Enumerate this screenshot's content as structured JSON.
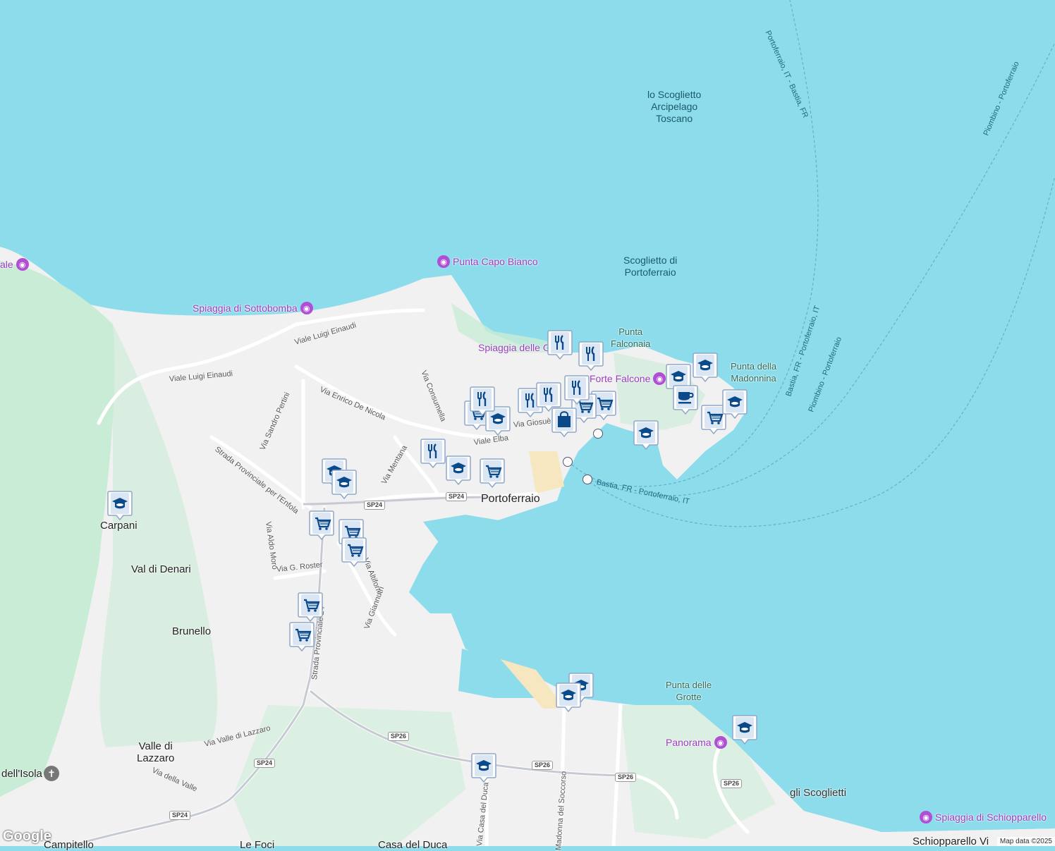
{
  "map": {
    "colors": {
      "water": "#8ddcec",
      "land": "#f2f2f2",
      "park": "#c8ecd4",
      "road": "#ffffff",
      "marker_blue": "#0b4a8a"
    },
    "water_labels": {
      "scoglietto_arcipelago": "lo Scoglietto\nArcipelago\nToscano",
      "scoglietto_portoferraio": "Scoglietto di\nPortoferraio",
      "punta_falconaia": "Punta\nFalconaia",
      "punta_madonnina": "Punta della\nMadonnina",
      "punta_grotte": "Punta delle\nGrotte",
      "gli_scoglietti": "gli Scoglietti"
    },
    "places": {
      "portoferraio": "Portoferraio",
      "carpani": "Carpani",
      "val_di_denari": "Val di Denari",
      "brunello": "Brunello",
      "valle_di_lazzaro": "Valle di\nLazzaro",
      "dell_isola": "dell'Isola",
      "campitello": "Campitello",
      "le_foci": "Le Foci",
      "casa_del_duca": "Casa del Duca",
      "schiopparello": "Schiopparello Vi"
    },
    "pois": {
      "punta_capo_bianco": "Punta Capo Bianco",
      "spiaggia_sottobomba": "Spiaggia di Sottobomba",
      "spiaggia_ghiaie": "Spiaggia delle G",
      "forte_falcone": "Forte Falcone",
      "panorama": "Panorama",
      "spiaggia_schiopparello": "Spiaggia di Schiopparello",
      "left_edge": "ale"
    },
    "roads": {
      "viale_luigi_einaudi_1": "Viale Luigi Einaudi",
      "viale_luigi_einaudi_2": "Viale Luigi Einaudi",
      "via_enrico_de_nicola": "Via Enrico De Nicola",
      "via_consumella": "Via Consumella",
      "via_sandro_pertini": "Via Sandro Pertini",
      "strada_enfola": "Strada Provinciale per l'Enfola",
      "via_mentana": "Via Mentana",
      "viale_elba": "Viale Elba",
      "via_giosue": "Via Giosuè C",
      "via_aldo_moro": "Via Aldo Moro",
      "via_g_roster": "Via G. Roster",
      "via_altiforni": "Via Altiforni",
      "via_giannutri": "Via Giannutri",
      "strada_provinciale_24": "Strada Provinciale 24",
      "via_valle_di_lazzaro": "Via Valle di Lazzaro",
      "via_della_valle": "Via della Valle",
      "via_casa_del_duca": "Via Casa del Duca",
      "via_madonna_soccorso": "Madonna del Soccorso"
    },
    "ferry_routes": {
      "portoferraio_bastia": "Portoferraio, IT - Bastia, FR",
      "piombino_portoferraio": "Piombino - Portoferraio",
      "bastia_portoferraio_1": "Bastia, FR - Portoferraio, IT",
      "piombino_portoferraio_2": "Piombino - Portoferraio",
      "bastia_portoferraio_2": "Bastia, FR - Portoferraio, IT"
    },
    "shields": {
      "sp24": "SP24",
      "sp26": "SP26"
    },
    "markers": [
      {
        "type": "cart"
      },
      {
        "type": "cart"
      },
      {
        "type": "cart"
      },
      {
        "type": "cart"
      },
      {
        "type": "cart"
      },
      {
        "type": "cart"
      },
      {
        "type": "cart"
      },
      {
        "type": "cart"
      },
      {
        "type": "cart"
      },
      {
        "type": "cart"
      },
      {
        "type": "school"
      },
      {
        "type": "school"
      },
      {
        "type": "school"
      },
      {
        "type": "school"
      },
      {
        "type": "school"
      },
      {
        "type": "school"
      },
      {
        "type": "school"
      },
      {
        "type": "school"
      },
      {
        "type": "school"
      },
      {
        "type": "school"
      },
      {
        "type": "school"
      },
      {
        "type": "school"
      },
      {
        "type": "school"
      },
      {
        "type": "food"
      },
      {
        "type": "food"
      },
      {
        "type": "food"
      },
      {
        "type": "food"
      },
      {
        "type": "food"
      },
      {
        "type": "food"
      },
      {
        "type": "food"
      },
      {
        "type": "bag"
      },
      {
        "type": "cafe"
      }
    ],
    "attribution": "Map data ©2025",
    "google_logo": "Google"
  }
}
